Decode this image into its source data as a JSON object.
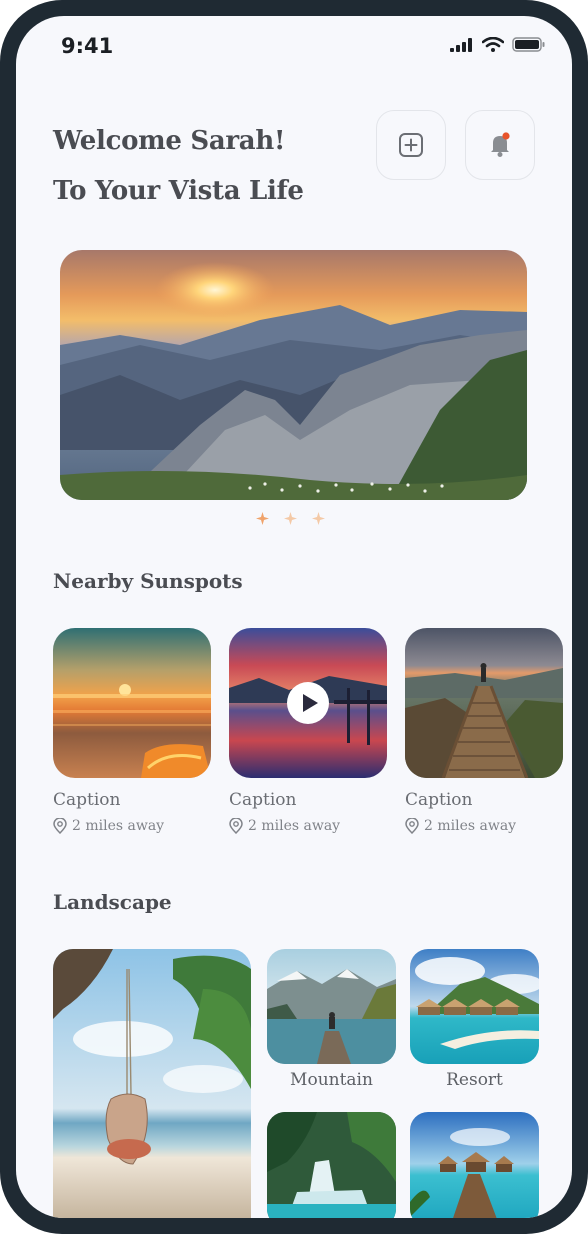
{
  "status": {
    "time": "9:41"
  },
  "header": {
    "line1": "Welcome Sarah!",
    "line2": "To Your Vista Life",
    "add_icon": "plus-square-icon",
    "bell_icon": "bell-icon"
  },
  "carousel": {
    "total_pages": 3,
    "active_page": 1
  },
  "nearby": {
    "title": "Nearby Sunspots",
    "items": [
      {
        "caption": "Caption",
        "distance": "2 miles away"
      },
      {
        "caption": "Caption",
        "distance": "2 miles away"
      },
      {
        "caption": "Caption",
        "distance": "2 miles away"
      }
    ]
  },
  "landscape": {
    "title": "Landscape",
    "tiles": [
      {
        "label": "Mountain"
      },
      {
        "label": "Resort"
      }
    ]
  },
  "colors": {
    "accent": "#f0a36b",
    "notification_dot": "#e8532a",
    "text_dark": "#4a4c52"
  }
}
